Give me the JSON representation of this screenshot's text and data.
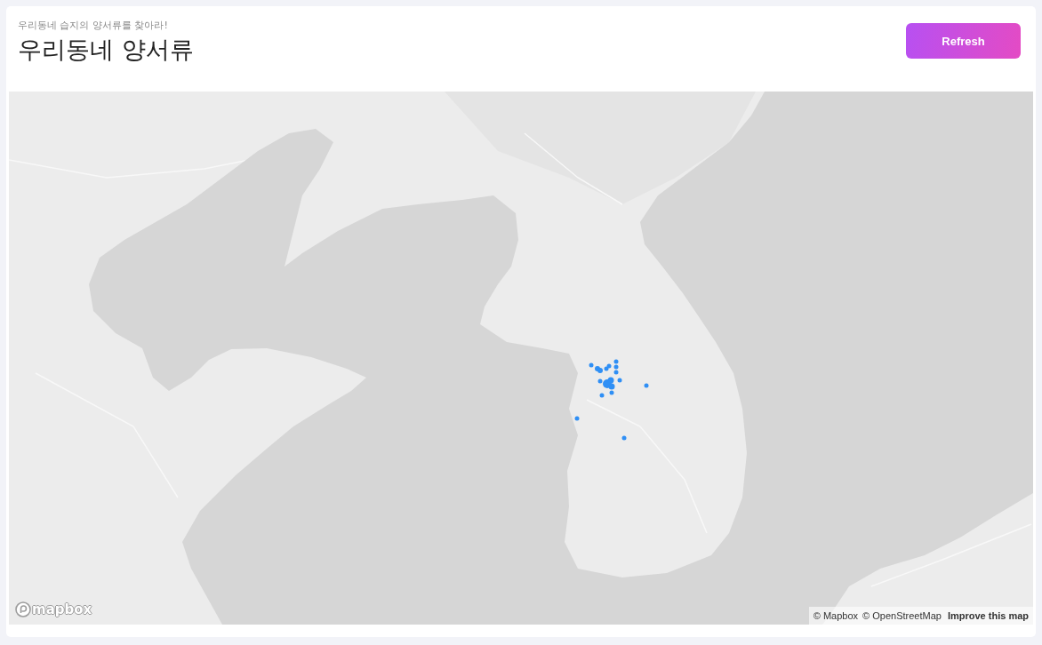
{
  "header": {
    "subtitle": "우리동네 습지의 양서류를 찾아라!",
    "title": "우리동네 양서류"
  },
  "refresh_button": {
    "label": "Refresh"
  },
  "map": {
    "logo": "mapbox",
    "attribution": [
      {
        "label": "© Mapbox",
        "kind": "link"
      },
      {
        "label": "© OpenStreetMap",
        "kind": "link"
      },
      {
        "label": "Improve this map",
        "kind": "action"
      }
    ]
  }
}
